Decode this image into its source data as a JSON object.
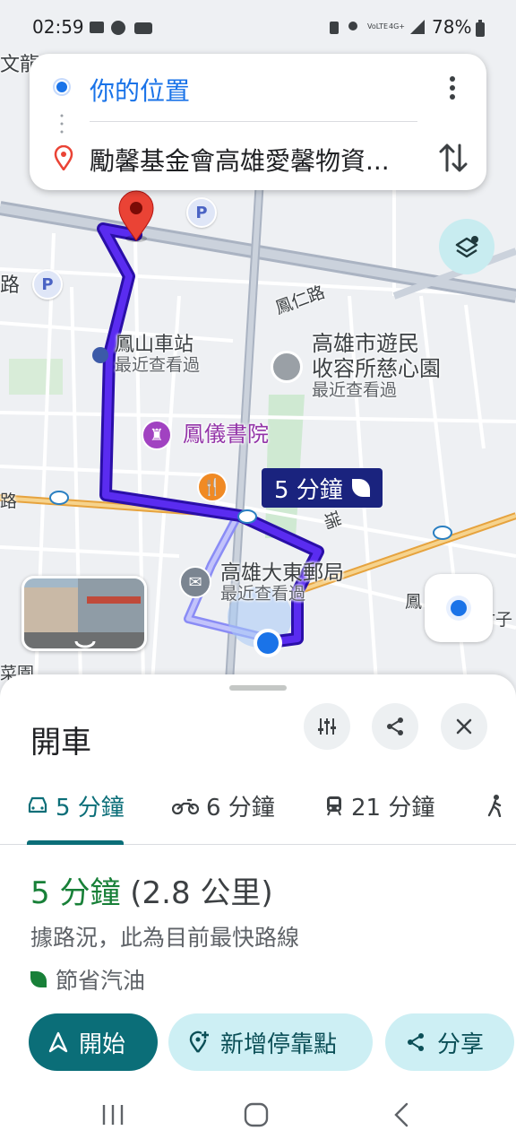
{
  "status_bar": {
    "time": "02:59",
    "battery": "78%"
  },
  "search": {
    "origin": "你的位置",
    "destination": "勵馨基金會高雄愛馨物資..."
  },
  "map": {
    "labels": {
      "wenlong": "文龍",
      "lu": "路",
      "fengren_rd": "鳳仁路",
      "fengshan_station": "鳳山車站",
      "station_recent": "最近查看過",
      "shelter_line1": "高雄市遊民",
      "shelter_line2": "收容所慈心園",
      "shelter_recent": "最近查看過",
      "academy": "鳳儀書院",
      "post_office": "高雄大東郵局",
      "post_recent": "最近查看過",
      "rui": "瑞",
      "feng": "鳳",
      "zhu": "竹子",
      "caiyuan": "菜園",
      "left_lu": "路"
    },
    "route_chip": "5 分鐘"
  },
  "sheet": {
    "title": "開車",
    "modes": [
      {
        "label": "5 分鐘",
        "icon": "car-icon"
      },
      {
        "label": "6 分鐘",
        "icon": "motorcycle-icon"
      },
      {
        "label": "21 分鐘",
        "icon": "transit-icon"
      }
    ],
    "summary_time": "5 分鐘",
    "summary_distance": "(2.8 公里)",
    "description": "據路況，此為目前最快路線",
    "eco": "節省汽油",
    "actions": {
      "start": "開始",
      "add_stop": "新增停靠點",
      "share": "分享"
    }
  },
  "colors": {
    "route": "#4b1fd6",
    "accent": "#0b6e78",
    "origin_blue": "#1a73e8",
    "dest_red": "#ea4335",
    "eco_green": "#188038"
  }
}
